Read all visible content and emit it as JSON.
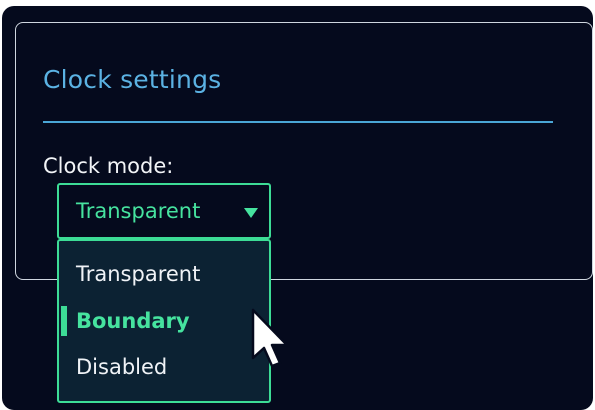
{
  "panel": {
    "title": "Clock settings"
  },
  "clock_mode": {
    "label": "Clock mode:",
    "selected_value": "Transparent",
    "options": [
      {
        "label": "Transparent"
      },
      {
        "label": "Boundary"
      },
      {
        "label": "Disabled"
      }
    ],
    "highlighted_option": "Boundary"
  },
  "icons": {
    "dropdown_arrow": "chevron-down-icon",
    "pointer": "mouse-cursor-icon"
  },
  "colors": {
    "background": "#050a1d",
    "accent": "#3ddc96",
    "title": "#5bb2e3",
    "dropdown_bg": "#0c2233",
    "text": "#f2f4f7"
  }
}
